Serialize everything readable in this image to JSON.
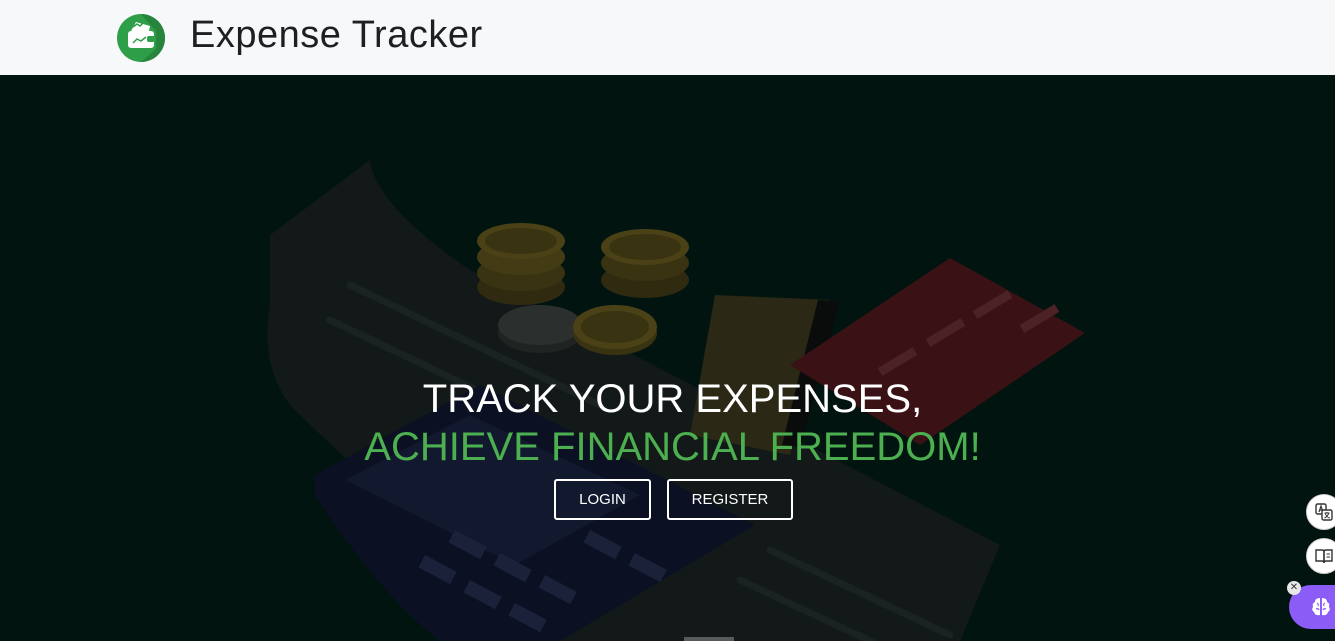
{
  "header": {
    "brand": "Expense Tracker",
    "logo_icon": "wallet-logo-icon"
  },
  "hero": {
    "headline_line1": "TRACK YOUR EXPENSES,",
    "headline_line2": "ACHIEVE FINANCIAL FREEDOM!",
    "login_label": "LOGIN",
    "register_label": "REGISTER"
  },
  "side_tools": {
    "translate_icon": "translate-icon",
    "reader_icon": "book-icon",
    "assistant_icon": "brain-icon",
    "close_glyph": "✕"
  },
  "colors": {
    "accent": "#4caf50",
    "navbar_bg": "#f7f8fa",
    "hero_bg": "#021410",
    "assistant": "#8b5cf6"
  }
}
